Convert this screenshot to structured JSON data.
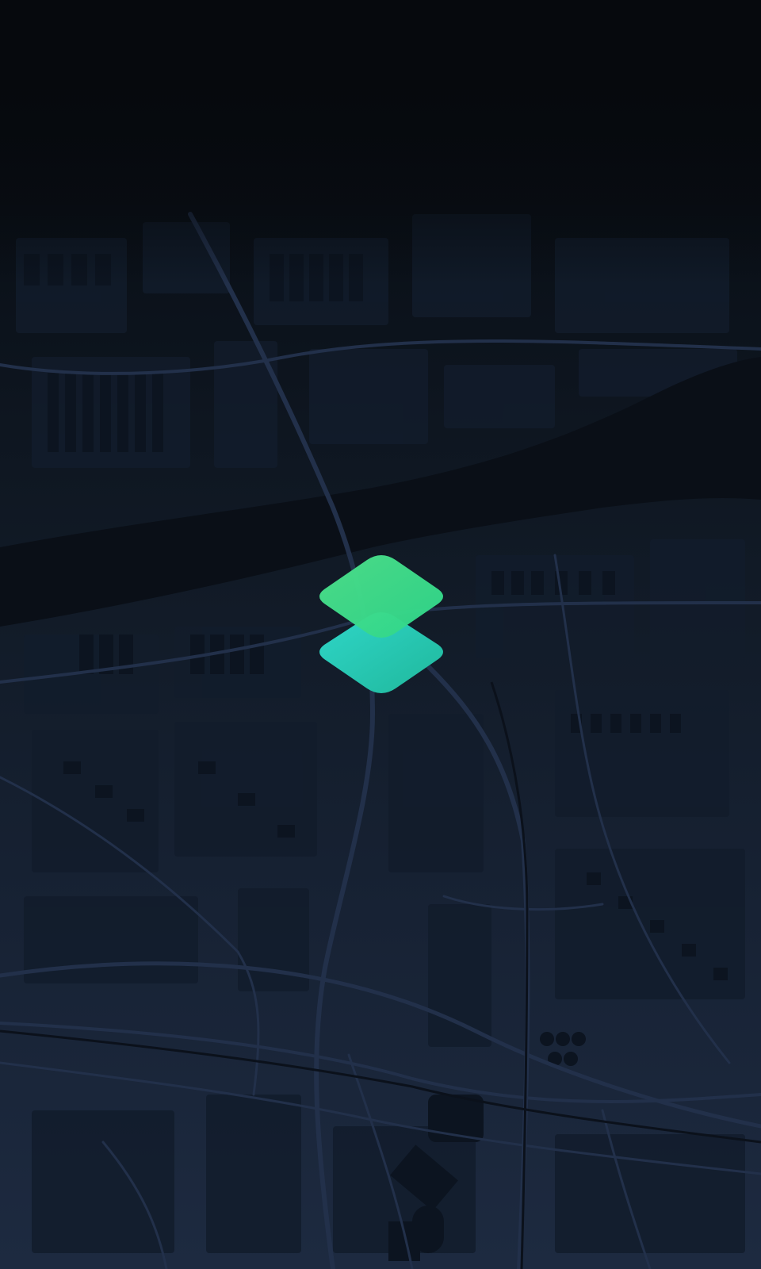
{
  "screen": {
    "type": "splash",
    "background": "dark-map",
    "logo_icon": "layers-icon"
  },
  "colors": {
    "background_top": "#070b10",
    "background_bottom": "#1d2a40",
    "map_buildings": "#0f1826",
    "map_roads": "#22304a",
    "river": "#0a0f17",
    "logo_top_a": "#3ddc84",
    "logo_top_b": "#2fd58f",
    "logo_bottom_a": "#29d4c4",
    "logo_bottom_b": "#1fb89c"
  }
}
